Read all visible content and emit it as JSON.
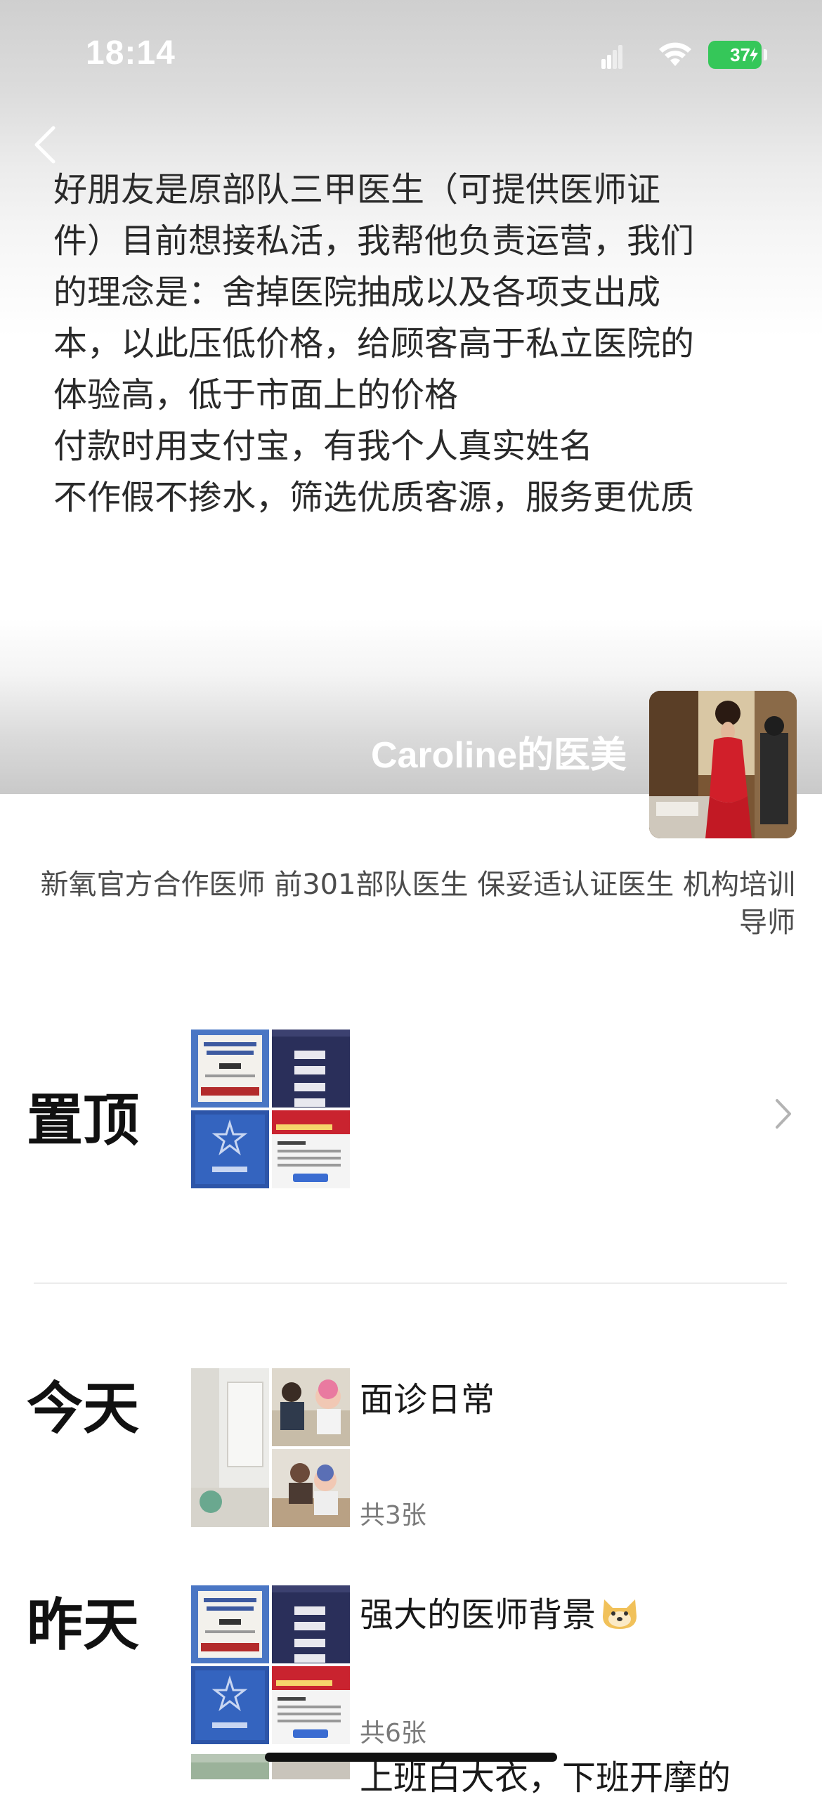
{
  "status_bar": {
    "time": "18:14",
    "battery": "37"
  },
  "cover": {
    "post_lines": [
      "好朋友是原部队三甲医生（可提供医师证",
      "件）目前想接私活，我帮他负责运营，我们",
      "的理念是：舍掉医院抽成以及各项支出成",
      "本，以此压低价格，给顾客高于私立医院的",
      "体验高，低于市面上的价格",
      "付款时用支付宝，有我个人真实姓名",
      "不作假不掺水，筛选优质客源，服务更优质"
    ],
    "username": "Caroline的医美"
  },
  "profile": {
    "signature": "新氧官方合作医师 前301部队医生 保妥适认证医生 机构培训导师"
  },
  "timeline": {
    "pinned": {
      "label": "置顶"
    },
    "entries": [
      {
        "label": "今天",
        "title": "面诊日常",
        "count": "共3张"
      },
      {
        "label": "昨天",
        "title": "强大的医师背景",
        "count": "共6张"
      },
      {
        "title": "上班白大衣，下班开摩的"
      }
    ]
  },
  "colors": {
    "battery_green": "#35c759",
    "cert_blue": "#2d55a8",
    "navy": "#2a2f5a",
    "text_dark": "#191919",
    "text_muted": "#7a7a7a"
  }
}
